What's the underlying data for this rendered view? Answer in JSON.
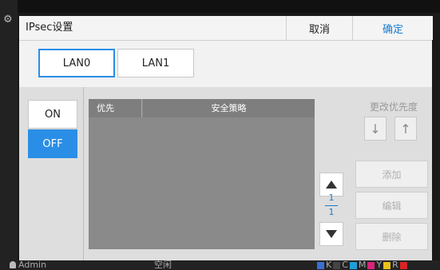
{
  "dialog": {
    "title": "IPsec设置",
    "cancel_label": "取消",
    "ok_label": "确定"
  },
  "tabs": [
    {
      "label": "LAN0",
      "active": true
    },
    {
      "label": "LAN1",
      "active": false
    }
  ],
  "toggle": {
    "on_label": "ON",
    "off_label": "OFF",
    "selected": "OFF"
  },
  "table": {
    "columns": [
      "优先",
      "安全策略"
    ],
    "rows": []
  },
  "priority": {
    "label": "更改优先度",
    "down_icon": "arrow-down-icon",
    "up_icon": "arrow-up-icon"
  },
  "pager": {
    "current": "1",
    "total": "1"
  },
  "actions": {
    "add_label": "添加",
    "edit_label": "编辑",
    "delete_label": "删除"
  },
  "status": {
    "user": "Admin",
    "state": "空闲",
    "ink": [
      "K",
      "C",
      "M",
      "Y",
      "R"
    ]
  },
  "colors": {
    "accent": "#2a8ee6",
    "ink_k": "#222222",
    "ink_c": "#1e9fd8",
    "ink_m": "#d8247a",
    "ink_y": "#e8c21a",
    "ink_r": "#d82424"
  }
}
